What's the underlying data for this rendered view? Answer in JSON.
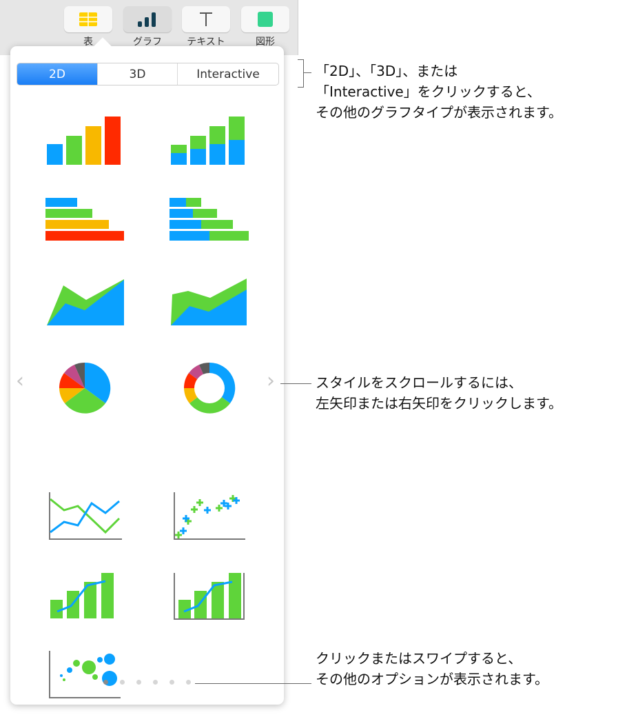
{
  "toolbar": {
    "buttons": [
      {
        "label": "表",
        "icon": "table-icon"
      },
      {
        "label": "グラフ",
        "icon": "chart-icon",
        "active": true
      },
      {
        "label": "テキスト",
        "icon": "text-icon"
      },
      {
        "label": "図形",
        "icon": "shape-icon"
      }
    ]
  },
  "popover": {
    "tabs": [
      "2D",
      "3D",
      "Interactive"
    ],
    "selected_tab": "2D",
    "chart_styles": [
      "column",
      "stacked-column",
      "bar",
      "stacked-bar",
      "area",
      "stacked-area",
      "pie",
      "donut",
      "line",
      "scatter",
      "mixed",
      "two-axis",
      "bubble"
    ],
    "page_count": 6,
    "current_page": 1
  },
  "callouts": {
    "tabs": "「2D」、「3D」、または\n「Interactive」をクリックすると、\nその他のグラフタイプが表示されます。",
    "arrows": "スタイルをスクロールするには、\n左矢印または右矢印をクリックします。",
    "dots": "クリックまたはスワイプすると、\nその他のオプションが表示されます。"
  },
  "colors": {
    "blue": "#0aa1ff",
    "green": "#5fd43a",
    "yellow": "#f8b800",
    "red": "#ff2a00",
    "accent": "#1a7ef5"
  }
}
